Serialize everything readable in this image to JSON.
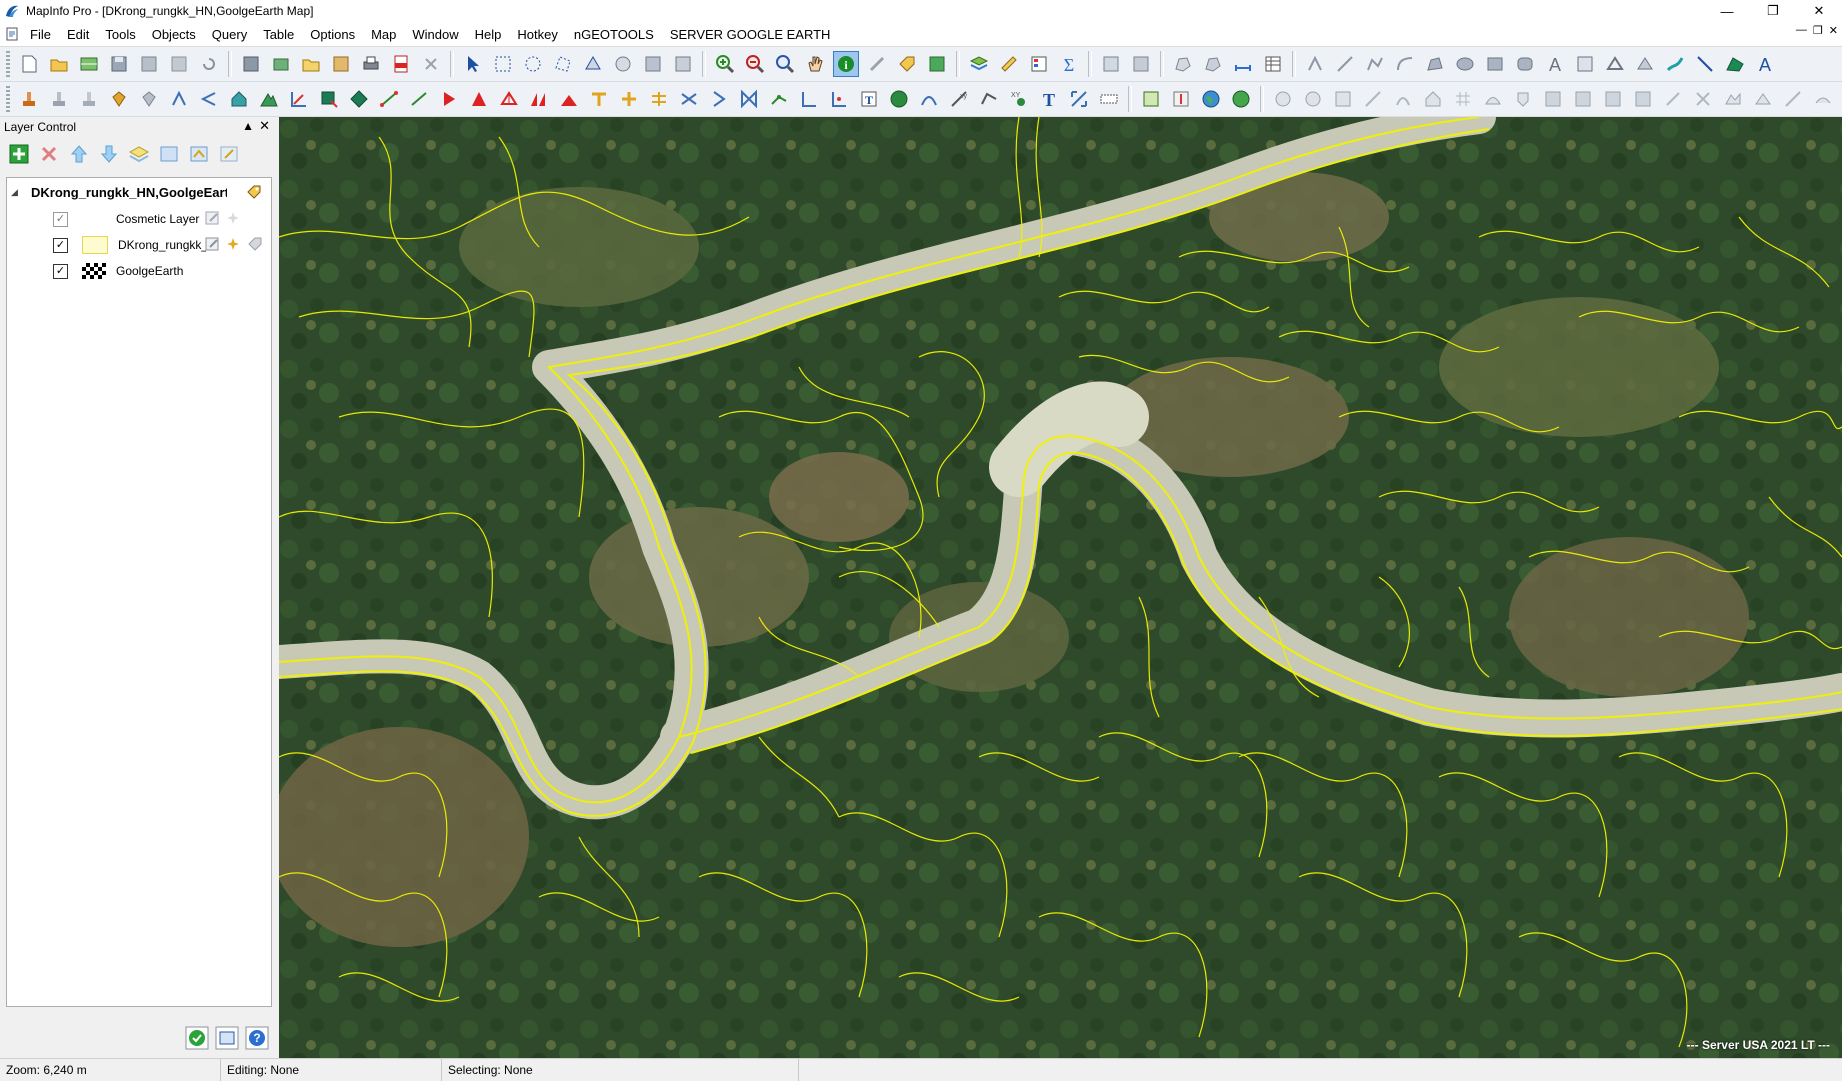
{
  "window": {
    "title": "MapInfo Pro - [DKrong_rungkk_HN,GoolgeEarth Map]",
    "controls": [
      "minimize-icon",
      "maximize-icon",
      "close-icon"
    ]
  },
  "menubar": {
    "items": [
      "File",
      "Edit",
      "Tools",
      "Objects",
      "Query",
      "Table",
      "Options",
      "Map",
      "Window",
      "Help",
      "Hotkey",
      "nGEOTOOLS",
      "SERVER GOOGLE EARTH"
    ]
  },
  "layer_control": {
    "title": "Layer Control",
    "map_name": "DKrong_rungkk_HN,GoolgeEarth M",
    "layers": [
      {
        "name": "Cosmetic Layer",
        "visible": true,
        "visibility_dimmed": true,
        "swatch": "none"
      },
      {
        "name": "DKrong_rungkk_",
        "visible": true,
        "visibility_dimmed": false,
        "swatch": "polygon-yellow"
      },
      {
        "name": "GoolgeEarth",
        "visible": true,
        "visibility_dimmed": false,
        "swatch": "raster-checker"
      }
    ]
  },
  "map": {
    "credit": "--- Server USA 2021 LT ---",
    "parcel_line_color": "#f2f200",
    "river_color": "#c9cbb9",
    "forest_color": "#2e4a2a"
  },
  "status": {
    "zoom": "Zoom: 6,240 m",
    "editing": "Editing: None",
    "selecting": "Selecting: None"
  }
}
